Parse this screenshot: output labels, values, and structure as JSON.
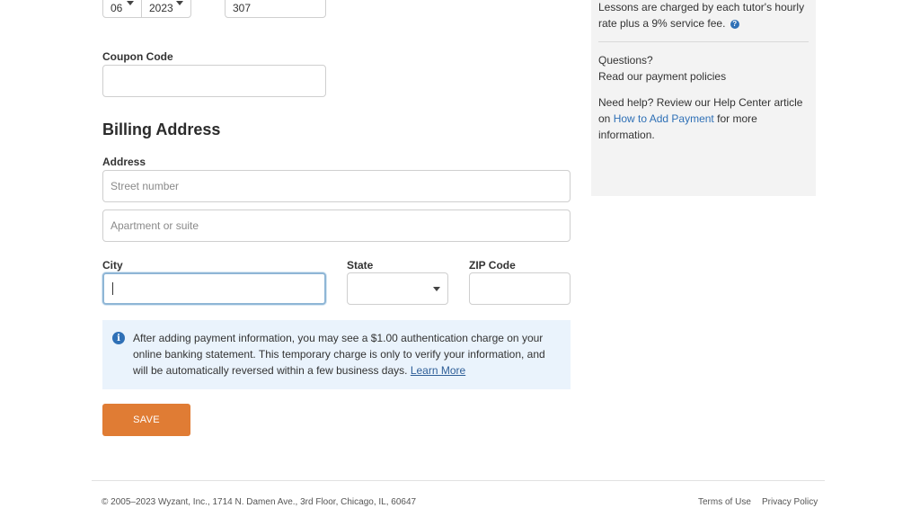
{
  "expiry": {
    "month": "06",
    "year": "2023",
    "cvv_value": "307"
  },
  "coupon": {
    "label": "Coupon Code",
    "value": ""
  },
  "billing": {
    "heading": "Billing Address",
    "address_label": "Address",
    "street_placeholder": "Street number",
    "apartment_placeholder": "Apartment or suite",
    "city_label": "City",
    "state_label": "State",
    "zip_label": "ZIP Code"
  },
  "notice": {
    "icon": "info-icon",
    "text": "After adding payment information, you may see a $1.00 authentication charge on your online banking statement. This temporary charge is only to verify your information, and will be automatically reversed within a few business days.",
    "link": "Learn More"
  },
  "save_button": "SAVE",
  "sidebar": {
    "rate_text": "Lessons are charged by each tutor's hourly rate plus a 9% service fee.",
    "questions_label": "Questions?",
    "policies_link": "Read our payment policies",
    "help_prefix": "Need help? Review our Help Center article on",
    "help_link": "How to Add Payment",
    "help_suffix": "for more information."
  },
  "footer": {
    "copyright": "© 2005–2023 Wyzant, Inc., 1714 N. Damen Ave., 3rd Floor, Chicago, IL, 60647",
    "terms": "Terms of Use",
    "privacy": "Privacy Policy"
  },
  "colors": {
    "accent_orange": "#e07c34",
    "link_blue": "#2f70b6",
    "info_bg": "#eaf3fc",
    "sidebar_bg": "#f3f3f3"
  }
}
